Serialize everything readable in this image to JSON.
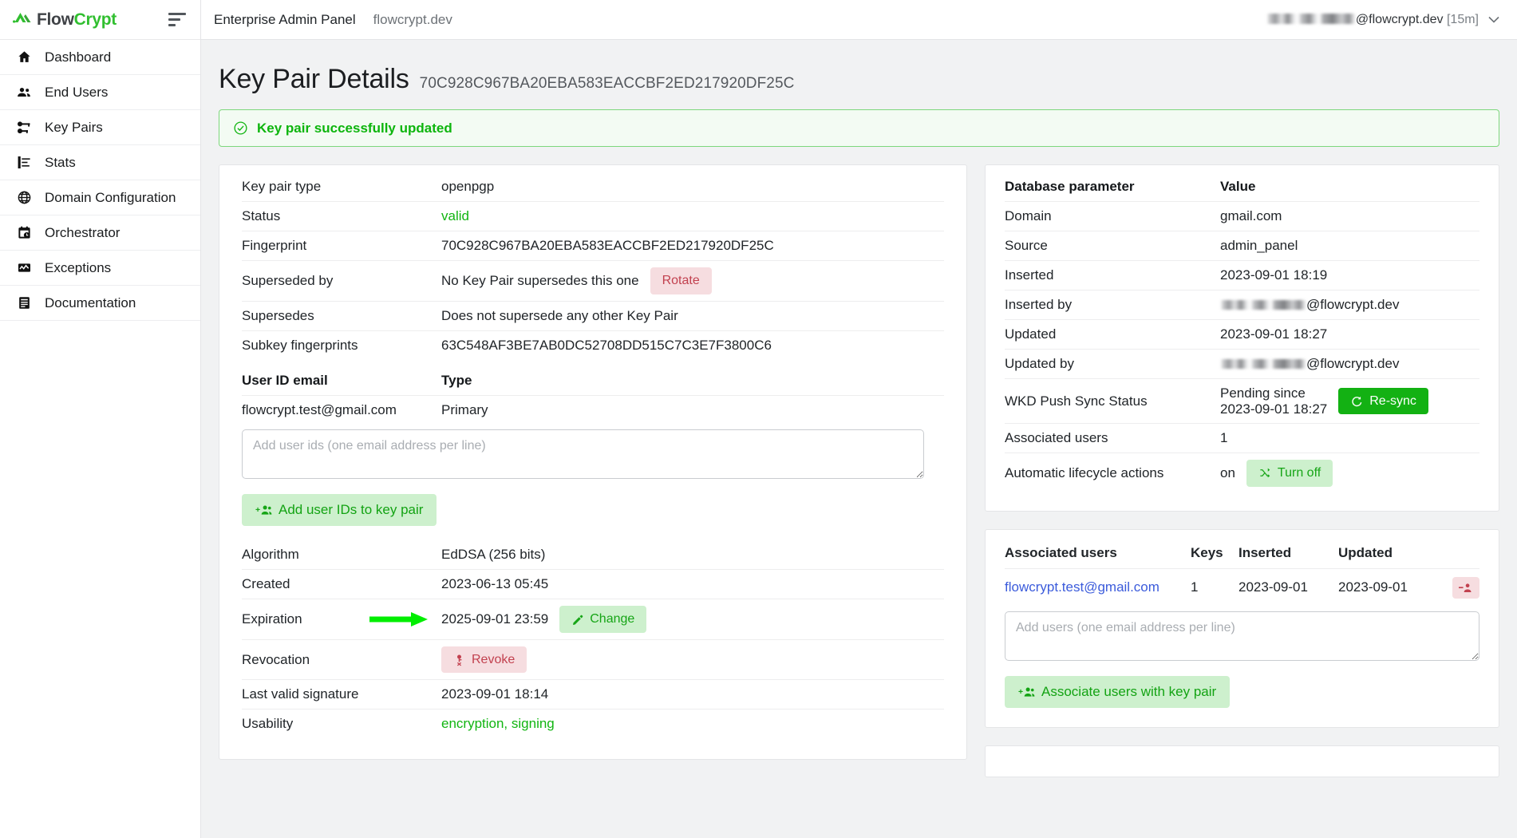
{
  "brand": {
    "flow": "Flow",
    "crypt": "Crypt"
  },
  "sidebar": {
    "items": [
      {
        "label": "Dashboard",
        "icon": "home-icon"
      },
      {
        "label": "End Users",
        "icon": "users-icon"
      },
      {
        "label": "Key Pairs",
        "icon": "key-icon"
      },
      {
        "label": "Stats",
        "icon": "chart-icon"
      },
      {
        "label": "Domain Configuration",
        "icon": "globe-icon"
      },
      {
        "label": "Orchestrator",
        "icon": "calendar-clock-icon"
      },
      {
        "label": "Exceptions",
        "icon": "exception-icon"
      },
      {
        "label": "Documentation",
        "icon": "document-icon"
      }
    ]
  },
  "topbar": {
    "title": "Enterprise Admin Panel",
    "subtitle": "flowcrypt.dev",
    "user_domain": "@flowcrypt.dev",
    "session": "[15m]",
    "chevron": "chevron-down-icon"
  },
  "page": {
    "title": "Key Pair Details",
    "fingerprint": "70C928C967BA20EBA583EACCBF2ED217920DF25C"
  },
  "alert": {
    "icon": "check-circle-icon",
    "message": "Key pair successfully updated"
  },
  "details": {
    "key_pair_type": {
      "label": "Key pair type",
      "value": "openpgp"
    },
    "status": {
      "label": "Status",
      "value": "valid"
    },
    "fingerprint": {
      "label": "Fingerprint",
      "value": "70C928C967BA20EBA583EACCBF2ED217920DF25C"
    },
    "superseded_by": {
      "label": "Superseded by",
      "value": "No Key Pair supersedes this one",
      "button": "Rotate"
    },
    "supersedes": {
      "label": "Supersedes",
      "value": "Does not supersede any other Key Pair"
    },
    "subkey_fingerprints": {
      "label": "Subkey fingerprints",
      "value": "63C548AF3BE7AB0DC52708DD515C7C3E7F3800C6"
    },
    "algorithm": {
      "label": "Algorithm",
      "value": "EdDSA (256 bits)"
    },
    "created": {
      "label": "Created",
      "value": "2023-06-13 05:45"
    },
    "expiration": {
      "label": "Expiration",
      "value": "2025-09-01 23:59",
      "button": "Change",
      "button_icon": "pencil-icon"
    },
    "revocation": {
      "label": "Revocation",
      "button": "Revoke",
      "button_icon": "key-off-icon"
    },
    "last_valid_signature": {
      "label": "Last valid signature",
      "value": "2023-09-01 18:14"
    },
    "usability": {
      "label": "Usability",
      "value": "encryption, signing"
    }
  },
  "user_ids": {
    "header_email": "User ID email",
    "header_type": "Type",
    "rows": [
      {
        "email": "flowcrypt.test@gmail.com",
        "type": "Primary"
      }
    ],
    "textarea_placeholder": "Add user ids (one email address per line)",
    "textarea_value": "",
    "add_button": "Add user IDs to key pair",
    "add_button_icon": "add-users-icon"
  },
  "database": {
    "header_param": "Database parameter",
    "header_value": "Value",
    "rows": [
      {
        "label": "Domain",
        "value": "gmail.com",
        "type": "text"
      },
      {
        "label": "Source",
        "value": "admin_panel",
        "type": "text"
      },
      {
        "label": "Inserted",
        "value": "2023-09-01 18:19",
        "type": "text"
      },
      {
        "label": "Inserted by",
        "value": "@flowcrypt.dev",
        "type": "redacted-email"
      },
      {
        "label": "Updated",
        "value": "2023-09-01 18:27",
        "type": "text"
      },
      {
        "label": "Updated by",
        "value": "@flowcrypt.dev",
        "type": "redacted-email"
      }
    ],
    "wkd": {
      "label": "WKD Push Sync Status",
      "value_line1": "Pending since",
      "value_line2": "2023-09-01 18:27",
      "button": "Re-sync",
      "button_icon": "refresh-icon"
    },
    "associated_users": {
      "label": "Associated users",
      "value": "1"
    },
    "lifecycle": {
      "label": "Automatic lifecycle actions",
      "value": "on",
      "button": "Turn off",
      "button_icon": "shuffle-off-icon"
    }
  },
  "associated_users_card": {
    "headers": [
      "Associated users",
      "Keys",
      "Inserted",
      "Updated"
    ],
    "rows": [
      {
        "email": "flowcrypt.test@gmail.com",
        "keys": "1",
        "inserted": "2023-09-01",
        "updated": "2023-09-01",
        "action_icon": "remove-user-icon"
      }
    ],
    "textarea_placeholder": "Add users (one email address per line)",
    "textarea_value": "",
    "add_button": "Associate users with key pair",
    "add_button_icon": "add-users-icon"
  },
  "colors": {
    "brand_green": "#31bf30",
    "success_green": "#0db50d",
    "solid_green": "#13b113",
    "soft_green_bg": "#cdf0cd",
    "soft_red_bg": "#f6dde0",
    "soft_red_fg": "#c2414f",
    "link_blue": "#3b5bdb",
    "annotation_arrow": "#00ee00",
    "page_bg": "#f1f2f3"
  }
}
